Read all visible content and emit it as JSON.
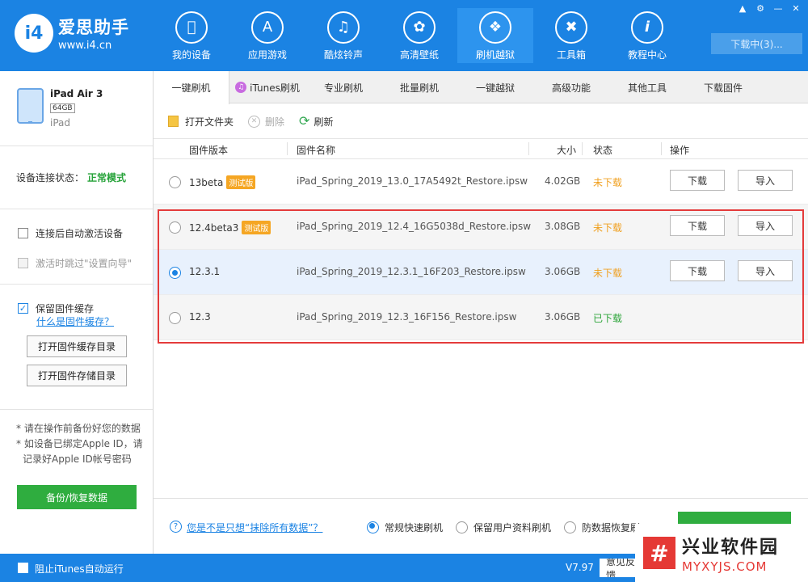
{
  "app": {
    "logo_mark": "i4",
    "name": "爱思助手",
    "url": "www.i4.cn"
  },
  "nav": [
    {
      "label": "我的设备",
      "icon": "apple-icon"
    },
    {
      "label": "应用游戏",
      "icon": "app-store-icon"
    },
    {
      "label": "酷炫铃声",
      "icon": "bell-icon"
    },
    {
      "label": "高清壁纸",
      "icon": "flower-icon"
    },
    {
      "label": "刷机越狱",
      "icon": "dropbox-icon"
    },
    {
      "label": "工具箱",
      "icon": "tools-icon"
    },
    {
      "label": "教程中心",
      "icon": "info-icon"
    }
  ],
  "download_button": "下载中(3)...",
  "device": {
    "name": "iPad Air 3",
    "capacity": "64GB",
    "type": "iPad"
  },
  "connection": {
    "label": "设备连接状态：",
    "value": "正常模式"
  },
  "options": {
    "auto_activate": "连接后自动激活设备",
    "skip_setup": "激活时跳过\"设置向导\""
  },
  "cache": {
    "keep_label": "保留固件缓存",
    "what_link": "什么是固件缓存？",
    "open_cache_dir": "打开固件缓存目录",
    "open_store_dir": "打开固件存储目录"
  },
  "notes": [
    "* 请在操作前备份好您的数据",
    "* 如设备已绑定Apple ID，请",
    "记录好Apple ID帐号密码"
  ],
  "backup_button": "备份/恢复数据",
  "tabs": [
    "一键刷机",
    "iTunes刷机",
    "专业刷机",
    "批量刷机",
    "一键越狱",
    "高级功能",
    "其他工具",
    "下载固件"
  ],
  "toolbar": {
    "open_folder": "打开文件夹",
    "delete": "删除",
    "refresh": "刷新"
  },
  "table": {
    "headers": {
      "version": "固件版本",
      "name": "固件名称",
      "size": "大小",
      "status": "状态",
      "action": "操作"
    },
    "rows": [
      {
        "version": "13beta",
        "beta": "测试版",
        "name": "iPad_Spring_2019_13.0_17A5492t_Restore.ipsw",
        "size": "4.02GB",
        "status": "未下载",
        "download": "下载",
        "import": "导入"
      },
      {
        "version": "12.4beta3",
        "beta": "测试版",
        "name": "iPad_Spring_2019_12.4_16G5038d_Restore.ipsw",
        "size": "3.08GB",
        "status": "未下载",
        "download": "下载",
        "import": "导入"
      },
      {
        "version": "12.3.1",
        "beta": "",
        "name": "iPad_Spring_2019_12.3.1_16F203_Restore.ipsw",
        "size": "3.06GB",
        "status": "未下载",
        "download": "下载",
        "import": "导入"
      },
      {
        "version": "12.3",
        "beta": "",
        "name": "iPad_Spring_2019_12.3_16F156_Restore.ipsw",
        "size": "3.06GB",
        "status": "已下载"
      }
    ]
  },
  "bottom": {
    "help_link": "您是不是只想“抹除所有数据”？",
    "modes": [
      "常规快速刷机",
      "保留用户资料刷机",
      "防数据恢复刷"
    ]
  },
  "statusbar": {
    "itunes_label": "阻止iTunes自动运行",
    "version": "V7.97",
    "feedback": "意见反馈"
  },
  "watermark": {
    "mark": "#",
    "name": "兴业软件园",
    "url": "MYXYJS.COM"
  },
  "colors": {
    "brand": "#1b83e3",
    "success": "#2fad3f",
    "warning": "#f0a020",
    "highlight": "#e43b3b"
  }
}
